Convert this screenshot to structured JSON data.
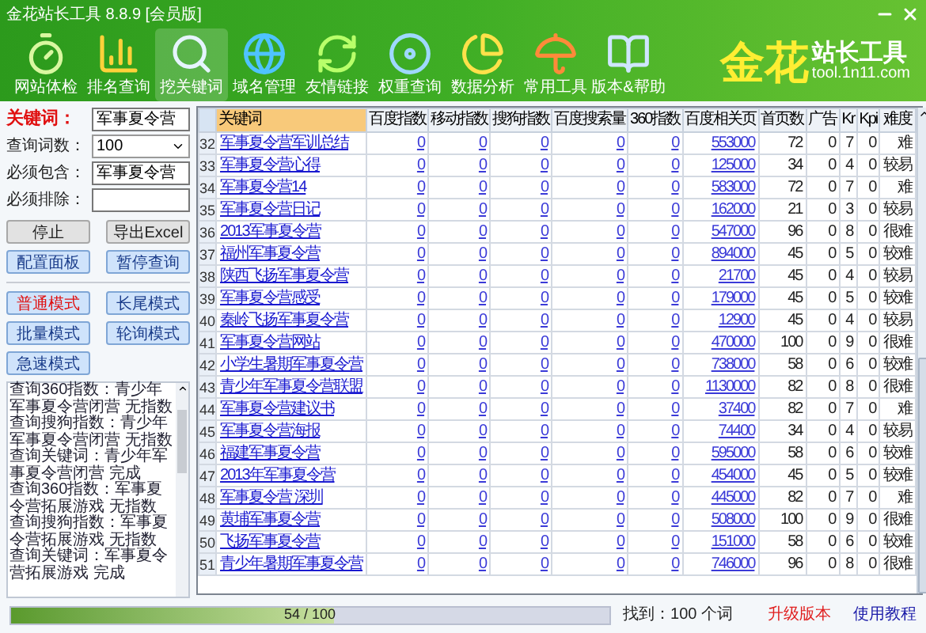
{
  "window": {
    "title": "金花站长工具 8.8.9 [会员版]"
  },
  "toolbar": [
    {
      "label": "网站体检",
      "selected": false
    },
    {
      "label": "排名查询",
      "selected": false
    },
    {
      "label": "挖关键词",
      "selected": true
    },
    {
      "label": "域名管理",
      "selected": false
    },
    {
      "label": "友情链接",
      "selected": false
    },
    {
      "label": "权重查询",
      "selected": false
    },
    {
      "label": "数据分析",
      "selected": false
    },
    {
      "label": "常用工具",
      "selected": false
    },
    {
      "label": "版本&帮助",
      "selected": false
    }
  ],
  "logo": {
    "brand": "金花",
    "name": "站长工具",
    "site": "tool.1n11.com"
  },
  "search_panel": {
    "fields": [
      {
        "label": "关键词：",
        "kind": "keyword",
        "value": "军事夏令营"
      },
      {
        "label": "查询词数：",
        "kind": "select",
        "value": "100"
      },
      {
        "label": "必须包含：",
        "kind": "text",
        "value": "军事夏令营"
      },
      {
        "label": "必须排除：",
        "kind": "text"
      }
    ]
  },
  "action_buttons": [
    {
      "label": "停止",
      "kind": "grey"
    },
    {
      "label": "导出Excel",
      "kind": "grey"
    },
    {
      "label": "配置面板",
      "kind": "blue"
    },
    {
      "label": "暂停查询",
      "kind": "blue"
    }
  ],
  "modes": [
    {
      "label": "普通模式",
      "selected": true
    },
    {
      "label": "长尾模式",
      "selected": false
    },
    {
      "label": "批量模式",
      "selected": false
    },
    {
      "label": "轮询模式",
      "selected": false
    },
    {
      "label": "急速模式",
      "selected": false
    }
  ],
  "log": [
    "查询360指数：青少年军事夏令营闭营 无指数",
    "查询搜狗指数：青少年军事夏令营闭营 无指数",
    "查询关键词：青少年军事夏令营闭营 完成",
    "查询360指数：军事夏令营拓展游戏 无指数",
    "查询搜狗指数：军事夏令营拓展游戏 无指数",
    "查询关键词：军事夏令营拓展游戏 完成"
  ],
  "table": {
    "columns": [
      {
        "label": "关键词",
        "kind": "keyword"
      },
      {
        "label": "百度指数",
        "kind": "link"
      },
      {
        "label": "移动指数",
        "kind": "link"
      },
      {
        "label": "搜狗指数",
        "kind": "link"
      },
      {
        "label": "百度搜索量",
        "kind": "link"
      },
      {
        "label": "360指数",
        "kind": "link"
      },
      {
        "label": "百度相关页",
        "kind": "link"
      },
      {
        "label": "首页数",
        "kind": "text"
      },
      {
        "label": "广告",
        "kind": "text"
      },
      {
        "label": "Kr",
        "kind": "text"
      },
      {
        "label": "Kpi",
        "kind": "text"
      },
      {
        "label": "难度",
        "kind": "text"
      }
    ],
    "rows": [
      {
        "number": "32",
        "cells": [
          "军事夏令营军训总结",
          "0",
          "0",
          "0",
          "0",
          "0",
          "553000",
          "72",
          "0",
          "7",
          "0",
          "难"
        ]
      },
      {
        "number": "33",
        "cells": [
          "军事夏令营心得",
          "0",
          "0",
          "0",
          "0",
          "0",
          "125000",
          "34",
          "0",
          "4",
          "0",
          "较易"
        ]
      },
      {
        "number": "34",
        "cells": [
          "军事夏令营14",
          "0",
          "0",
          "0",
          "0",
          "0",
          "583000",
          "72",
          "0",
          "7",
          "0",
          "难"
        ]
      },
      {
        "number": "35",
        "cells": [
          "军事夏令营日记",
          "0",
          "0",
          "0",
          "0",
          "0",
          "162000",
          "21",
          "0",
          "3",
          "0",
          "较易"
        ]
      },
      {
        "number": "36",
        "cells": [
          "2013军事夏令营",
          "0",
          "0",
          "0",
          "0",
          "0",
          "547000",
          "96",
          "0",
          "8",
          "0",
          "很难"
        ]
      },
      {
        "number": "37",
        "cells": [
          "福州军事夏令营",
          "0",
          "0",
          "0",
          "0",
          "0",
          "894000",
          "45",
          "0",
          "5",
          "0",
          "较难"
        ]
      },
      {
        "number": "38",
        "cells": [
          "陕西飞扬军事夏令营",
          "0",
          "0",
          "0",
          "0",
          "0",
          "21700",
          "45",
          "0",
          "4",
          "0",
          "较易"
        ]
      },
      {
        "number": "39",
        "cells": [
          "军事夏令营感受",
          "0",
          "0",
          "0",
          "0",
          "0",
          "179000",
          "45",
          "0",
          "5",
          "0",
          "较难"
        ]
      },
      {
        "number": "40",
        "cells": [
          "秦岭飞扬军事夏令营",
          "0",
          "0",
          "0",
          "0",
          "0",
          "12900",
          "45",
          "0",
          "4",
          "0",
          "较易"
        ]
      },
      {
        "number": "41",
        "cells": [
          "军事夏令营网站",
          "0",
          "0",
          "0",
          "0",
          "0",
          "470000",
          "100",
          "0",
          "9",
          "0",
          "很难"
        ]
      },
      {
        "number": "42",
        "cells": [
          "小学生暑期军事夏令营",
          "0",
          "0",
          "0",
          "0",
          "0",
          "738000",
          "58",
          "0",
          "6",
          "0",
          "较难"
        ]
      },
      {
        "number": "43",
        "cells": [
          "青少年军事夏令营联盟",
          "0",
          "0",
          "0",
          "0",
          "0",
          "1130000",
          "82",
          "0",
          "8",
          "0",
          "很难"
        ]
      },
      {
        "number": "44",
        "cells": [
          "军事夏令营建议书",
          "0",
          "0",
          "0",
          "0",
          "0",
          "37400",
          "82",
          "0",
          "7",
          "0",
          "难"
        ]
      },
      {
        "number": "45",
        "cells": [
          "军事夏令营海报",
          "0",
          "0",
          "0",
          "0",
          "0",
          "74400",
          "34",
          "0",
          "4",
          "0",
          "较易"
        ]
      },
      {
        "number": "46",
        "cells": [
          "福建军事夏令营",
          "0",
          "0",
          "0",
          "0",
          "0",
          "595000",
          "58",
          "0",
          "6",
          "0",
          "较难"
        ]
      },
      {
        "number": "47",
        "cells": [
          "2013年军事夏令营",
          "0",
          "0",
          "0",
          "0",
          "0",
          "454000",
          "45",
          "0",
          "5",
          "0",
          "较难"
        ]
      },
      {
        "number": "48",
        "cells": [
          "军事夏令营 深圳",
          "0",
          "0",
          "0",
          "0",
          "0",
          "445000",
          "82",
          "0",
          "7",
          "0",
          "难"
        ]
      },
      {
        "number": "49",
        "cells": [
          "黄埔军事夏令营",
          "0",
          "0",
          "0",
          "0",
          "0",
          "508000",
          "100",
          "0",
          "9",
          "0",
          "很难"
        ]
      },
      {
        "number": "50",
        "cells": [
          "飞扬军事夏令营",
          "0",
          "0",
          "0",
          "0",
          "0",
          "151000",
          "58",
          "0",
          "6",
          "0",
          "较难"
        ]
      },
      {
        "number": "51",
        "cells": [
          "青少年暑期军事夏令营",
          "0",
          "0",
          "0",
          "0",
          "0",
          "746000",
          "96",
          "0",
          "8",
          "0",
          "很难"
        ]
      }
    ]
  },
  "status_bar": {
    "progress": {
      "level": 0.54,
      "text": "54 / 100"
    },
    "found": "找到：100 个词",
    "links": [
      {
        "label": "升级版本",
        "color": "#e02020"
      },
      {
        "label": "使用教程",
        "color": "#1a1aa8"
      }
    ]
  }
}
